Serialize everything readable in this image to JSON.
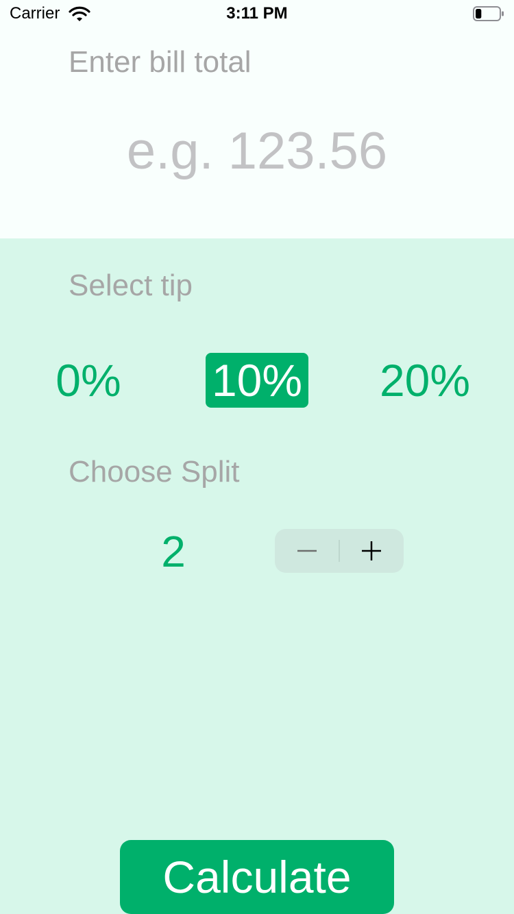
{
  "status_bar": {
    "carrier": "Carrier",
    "time": "3:11 PM",
    "battery_level": 0.25
  },
  "bill": {
    "label": "Enter bill total",
    "value": "",
    "placeholder": "e.g. 123.56"
  },
  "tip": {
    "label": "Select tip",
    "options": [
      "0%",
      "10%",
      "20%"
    ],
    "selected": "10%"
  },
  "split": {
    "label": "Choose Split",
    "value": "2"
  },
  "calculate_label": "Calculate",
  "colors": {
    "accent": "#00B06B",
    "top_background": "#F9FFFD",
    "bottom_background": "#D7F7EA",
    "label_gray": "#A6A6A6",
    "placeholder_gray": "#C2C2C4",
    "stepper_background": "#CFE8DF"
  },
  "icons": [
    "wifi-icon",
    "battery-icon",
    "minus-icon",
    "plus-icon"
  ]
}
